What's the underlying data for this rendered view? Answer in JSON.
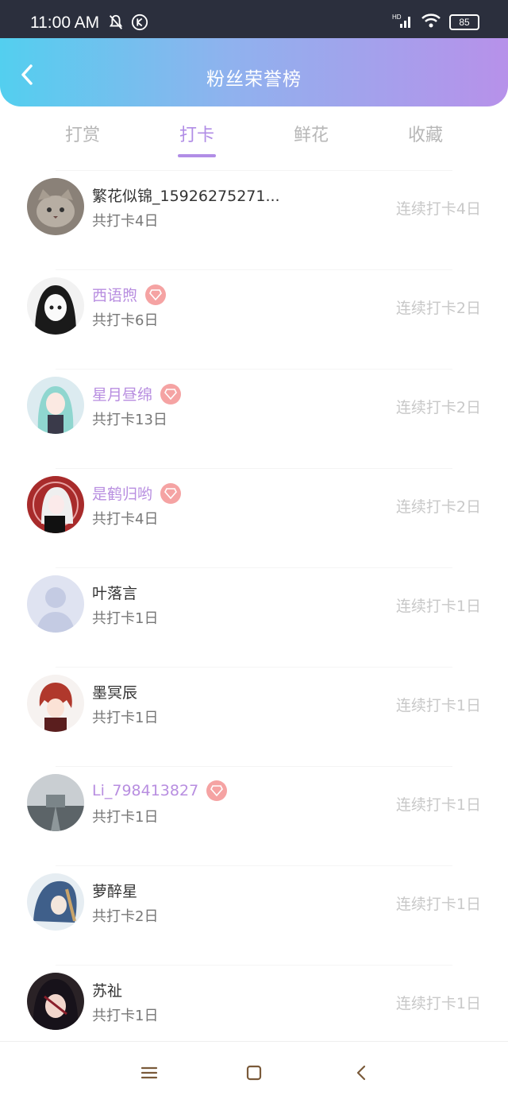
{
  "status": {
    "time": "11:00 AM",
    "battery": "85",
    "network": "HD"
  },
  "header": {
    "title": "粉丝荣誉榜"
  },
  "tabs": [
    {
      "label": "打赏",
      "active": false
    },
    {
      "label": "打卡",
      "active": true
    },
    {
      "label": "鲜花",
      "active": false
    },
    {
      "label": "收藏",
      "active": false
    }
  ],
  "fans": [
    {
      "name": "繁花似锦_15926275271...",
      "vip": false,
      "total": "共打卡4日",
      "streak": "连续打卡4日",
      "avatar": "cat"
    },
    {
      "name": "西语煦",
      "vip": true,
      "total": "共打卡6日",
      "streak": "连续打卡2日",
      "avatar": "anime-bw"
    },
    {
      "name": "星月昼绵",
      "vip": true,
      "total": "共打卡13日",
      "streak": "连续打卡2日",
      "avatar": "anime-teal"
    },
    {
      "name": "是鹤归哟",
      "vip": true,
      "total": "共打卡4日",
      "streak": "连续打卡2日",
      "avatar": "anime-red"
    },
    {
      "name": "叶落言",
      "vip": false,
      "total": "共打卡1日",
      "streak": "连续打卡1日",
      "avatar": "default"
    },
    {
      "name": "墨冥辰",
      "vip": false,
      "total": "共打卡1日",
      "streak": "连续打卡1日",
      "avatar": "anime-redhair"
    },
    {
      "name": "Li_798413827",
      "vip": true,
      "total": "共打卡1日",
      "streak": "连续打卡1日",
      "avatar": "landscape"
    },
    {
      "name": "萝醉星",
      "vip": false,
      "total": "共打卡2日",
      "streak": "连续打卡1日",
      "avatar": "anime-blue"
    },
    {
      "name": "苏祉",
      "vip": false,
      "total": "共打卡1日",
      "streak": "连续打卡1日",
      "avatar": "anime-dark"
    }
  ],
  "colors": {
    "accent": "#b18de6",
    "vip_name": "#b88ee0",
    "badge": "#f5a3a3"
  }
}
